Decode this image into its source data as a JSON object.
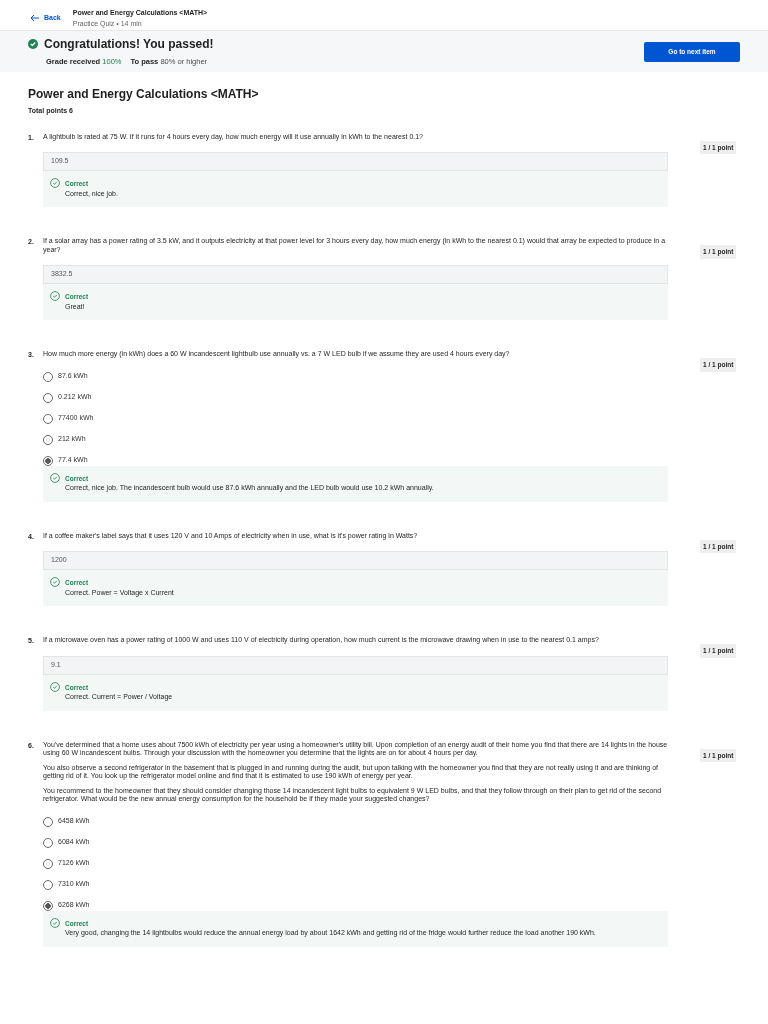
{
  "header": {
    "back": "Back",
    "title": "Power and Energy Calculations <MATH>",
    "subtitle": "Practice Quiz • 14 min"
  },
  "banner": {
    "title": "Congratulations! You passed!",
    "grade_label": "Grade received",
    "grade": "100%",
    "pass_label": "To pass",
    "pass_value": "80% or higher",
    "button": "Go to next item"
  },
  "quiz": {
    "title": "Power and Energy Calculations <MATH>",
    "total": "Total points 6"
  },
  "questions": [
    {
      "number": "1.",
      "kind": "text",
      "paragraphs": [
        "A lightbulb is rated at 75 W. If it runs for 4 hours every day, how much energy will it use annually in kWh to the nearest 0.1?"
      ],
      "points": "1 / 1 point",
      "answer": "109.5",
      "feedback_label": "Correct",
      "feedback": "Correct, nice job."
    },
    {
      "number": "2.",
      "kind": "text",
      "paragraphs": [
        "If a solar array has a power rating of 3.5 kW, and it outputs electricity at that power level for 3 hours every day, how much energy (in kWh to the nearest 0.1) would that array be expected to produce in a year?"
      ],
      "points": "1 / 1 point",
      "answer": "3832.5",
      "feedback_label": "Correct",
      "feedback": "Great!"
    },
    {
      "number": "3.",
      "kind": "choice",
      "paragraphs": [
        "How much more energy (in kWh) does a 60 W incandescent lightbulb use annually vs. a 7 W LED bulb if we assume they are used 4 hours every day?"
      ],
      "points": "1 / 1 point",
      "options": [
        {
          "label": "87.6 kWh",
          "selected": false
        },
        {
          "label": "0.212 kWh",
          "selected": false
        },
        {
          "label": "77400 kWh",
          "selected": false
        },
        {
          "label": "212 kWh",
          "selected": false
        },
        {
          "label": "77.4 kWh",
          "selected": true
        }
      ],
      "feedback_label": "Correct",
      "feedback": "Correct, nice job. The incandescent bulb would use 87.6 kWh annually and the LED bulb would use 10.2 kWh annually."
    },
    {
      "number": "4.",
      "kind": "text",
      "paragraphs": [
        "If a coffee maker's label says that it uses 120 V and 10 Amps of electricity when in use, what is it's power rating in Watts?"
      ],
      "points": "1 / 1 point",
      "answer": "1200",
      "feedback_label": "Correct",
      "feedback": "Correct. Power = Voltage x Current"
    },
    {
      "number": "5.",
      "kind": "text",
      "paragraphs": [
        "If a microwave oven has a power rating of 1000 W and uses 110 V of electricity during operation, how much current is the microwave drawing when in use to the nearest 0.1 amps?"
      ],
      "points": "1 / 1 point",
      "answer": "9.1",
      "feedback_label": "Correct",
      "feedback": "Correct. Current = Power / Voltage"
    },
    {
      "number": "6.",
      "kind": "choice",
      "paragraphs": [
        "You've determined that a home uses about 7500 kWh of electricity per year using a homeowner's utility bill. Upon completion of an energy audit of their home you find that there are 14 lights in the house using 60 W incandescent bulbs. Through your discussion with the homeowner you determine that the lights are on for about 4 hours per day.",
        "You also observe a second refrigerator in the basement that is plugged in and running during the audit, but upon talking with the homeowner you find that they are not really using it and are thinking of getting rid of it. You look up the refrigerator model online and find that it is estimated to use 190 kWh of energy per year.",
        "You recommend to the homeowner that they should consider changing those 14 incandescent light bulbs to equivalent 9 W LED bulbs, and that they follow through on their plan to get rid of the second refrigerator. What would be the new annual energy consumption for the household be if they made your suggested changes?"
      ],
      "points": "1 / 1 point",
      "options": [
        {
          "label": "6458 kWh",
          "selected": false
        },
        {
          "label": "6084 kWh",
          "selected": false
        },
        {
          "label": "7126 kWh",
          "selected": false
        },
        {
          "label": "7310 kWh",
          "selected": false
        },
        {
          "label": "6268 kWh",
          "selected": true
        }
      ],
      "feedback_label": "Correct",
      "feedback": "Very good, changing the 14 lightbulbs would reduce the annual energy load by about 1642 kWh and getting rid of the fridge would further reduce the load another 190 kWh."
    }
  ]
}
